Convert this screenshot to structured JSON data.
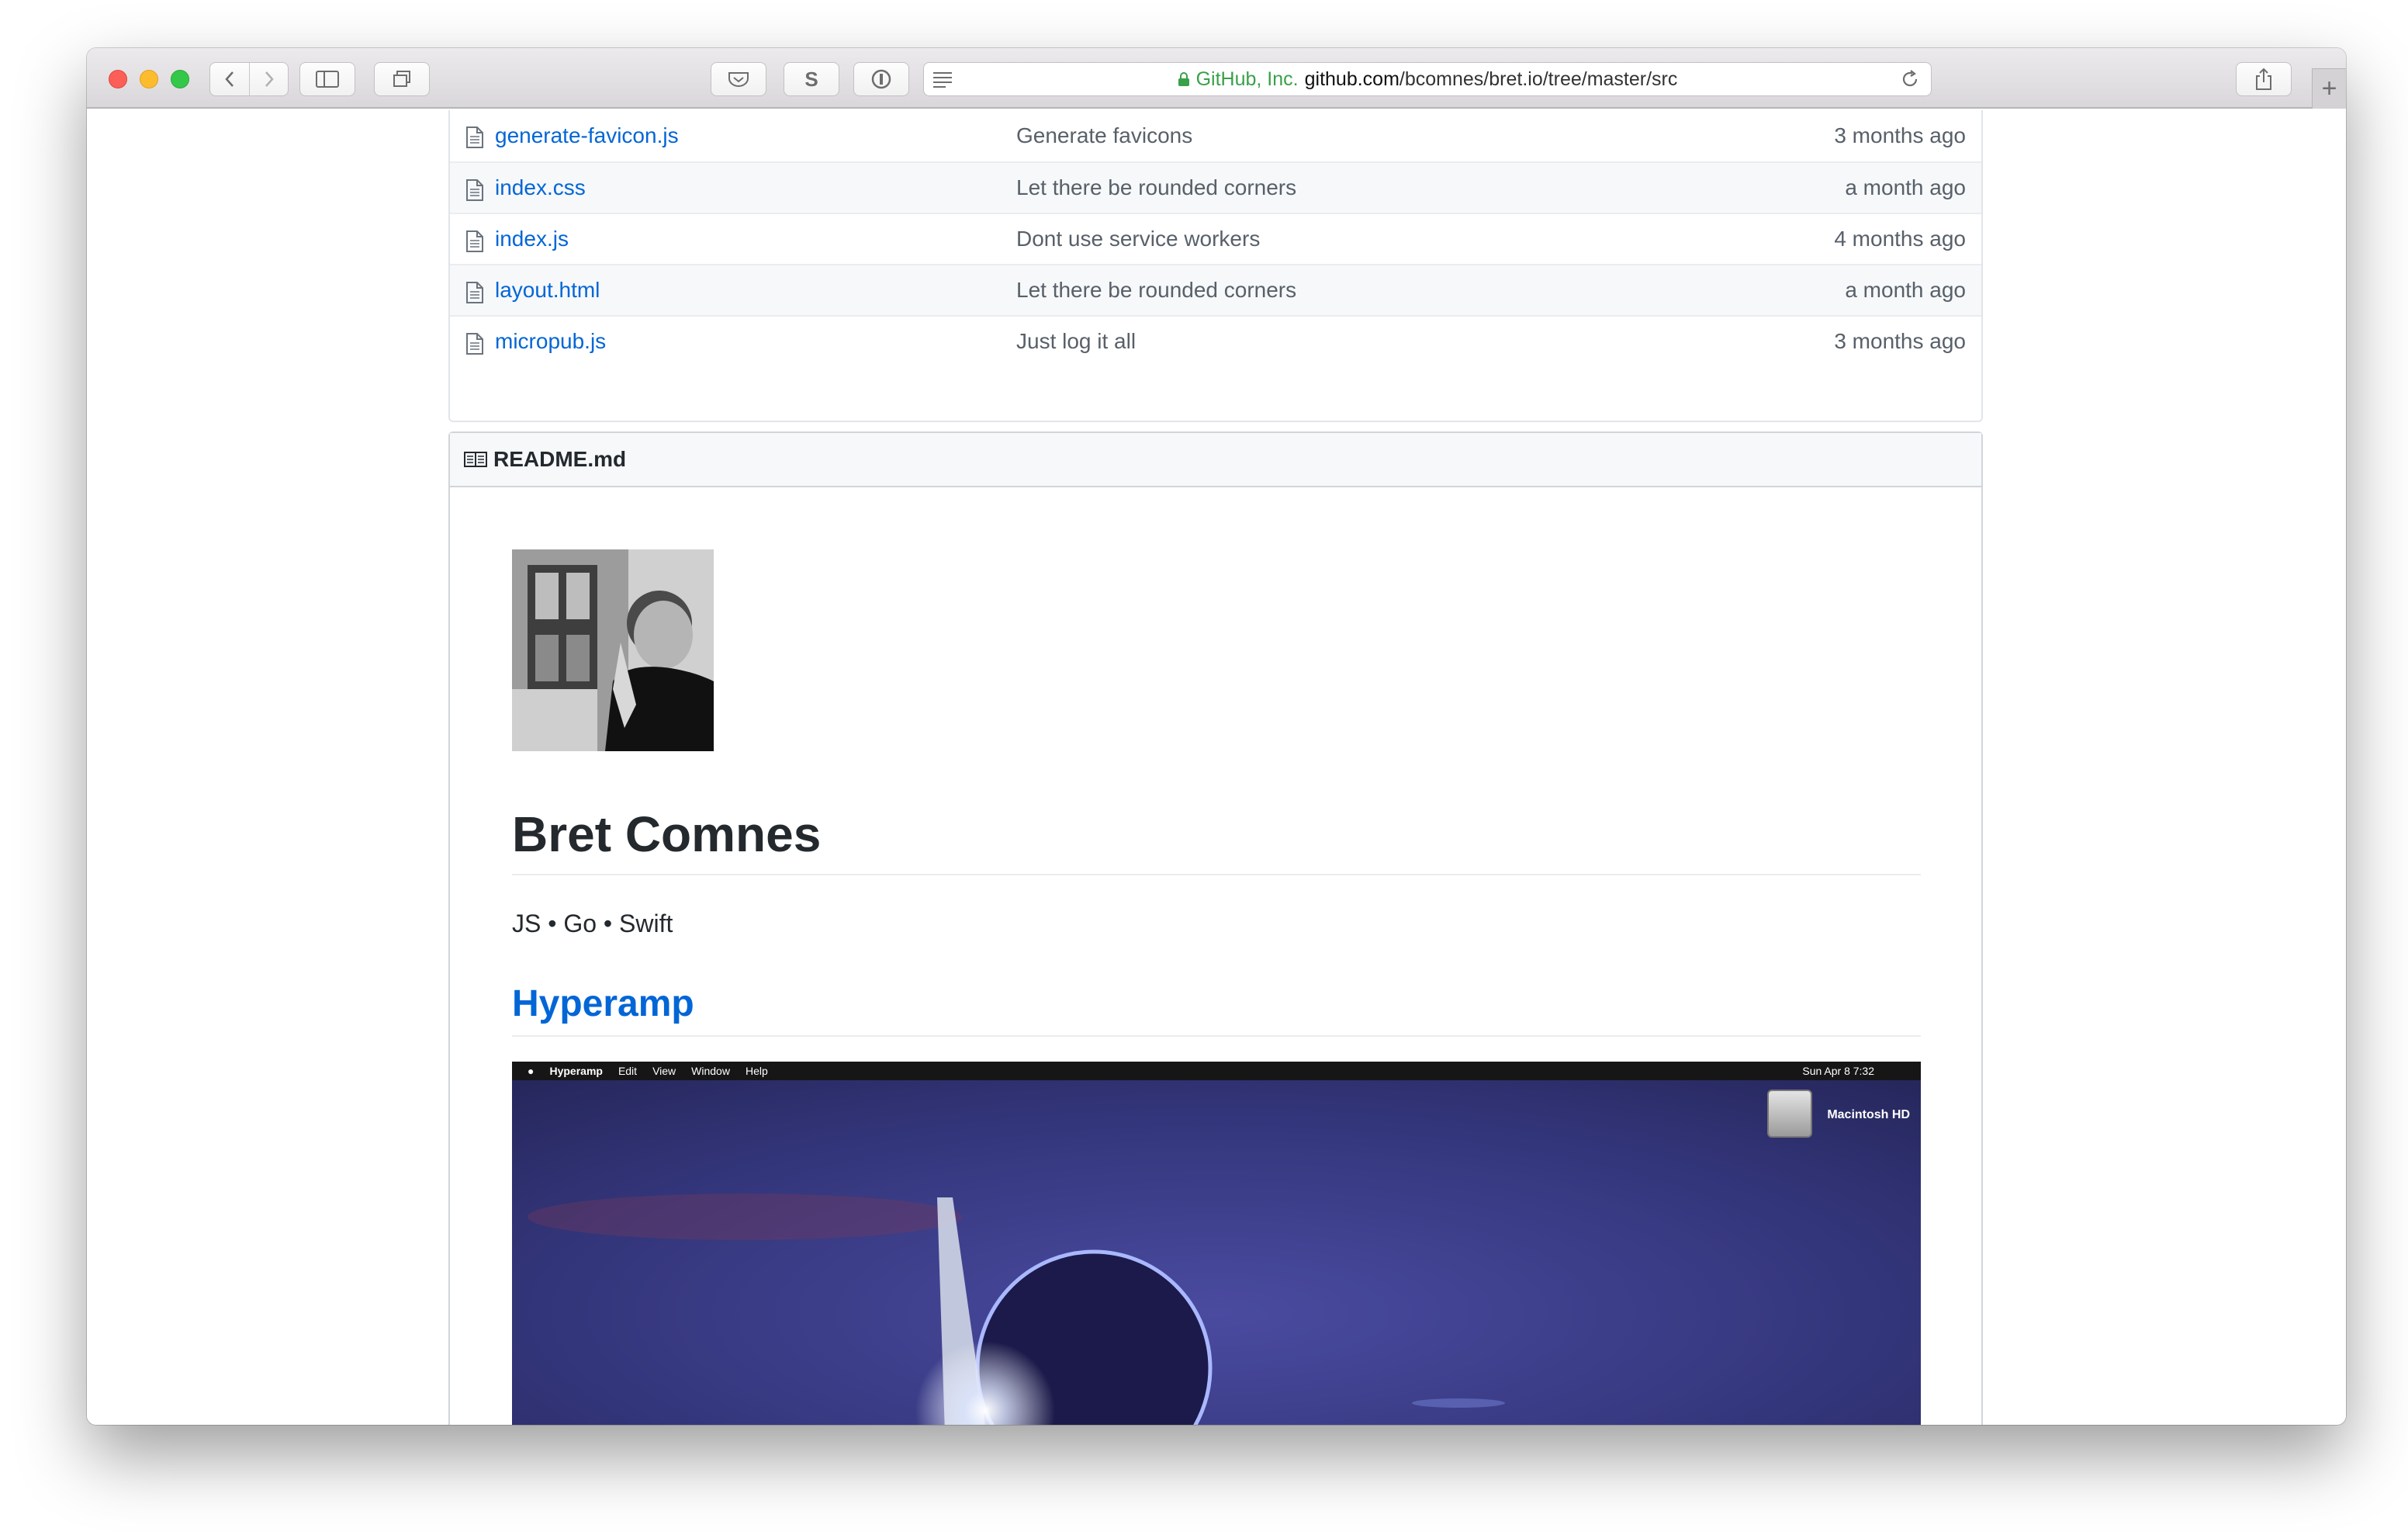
{
  "browser": {
    "address": {
      "owner": "GitHub, Inc.",
      "domain": "github.com",
      "path": "/bcomnes/bret.io/tree/master/src"
    },
    "extension_s_label": "S",
    "new_tab_label": "+"
  },
  "files": [
    {
      "name": "generate-favicon.js",
      "message": "Generate favicons",
      "age": "3 months ago"
    },
    {
      "name": "index.css",
      "message": "Let there be rounded corners",
      "age": "a month ago"
    },
    {
      "name": "index.js",
      "message": "Dont use service workers",
      "age": "4 months ago"
    },
    {
      "name": "layout.html",
      "message": "Let there be rounded corners",
      "age": "a month ago"
    },
    {
      "name": "micropub.js",
      "message": "Just log it all",
      "age": "3 months ago"
    }
  ],
  "readme": {
    "filename": "README.md",
    "title": "Bret Comnes",
    "tagline": "JS • Go • Swift",
    "project_heading": "Hyperamp",
    "screenshot": {
      "app_name": "Hyperamp",
      "menus": [
        "Edit",
        "View",
        "Window",
        "Help"
      ],
      "clock": "Sun Apr 8  7:32",
      "drive_label": "Macintosh HD"
    }
  },
  "colors": {
    "link": "#0366d6",
    "secure_green": "#3aa04a",
    "muted_text": "#586069"
  }
}
